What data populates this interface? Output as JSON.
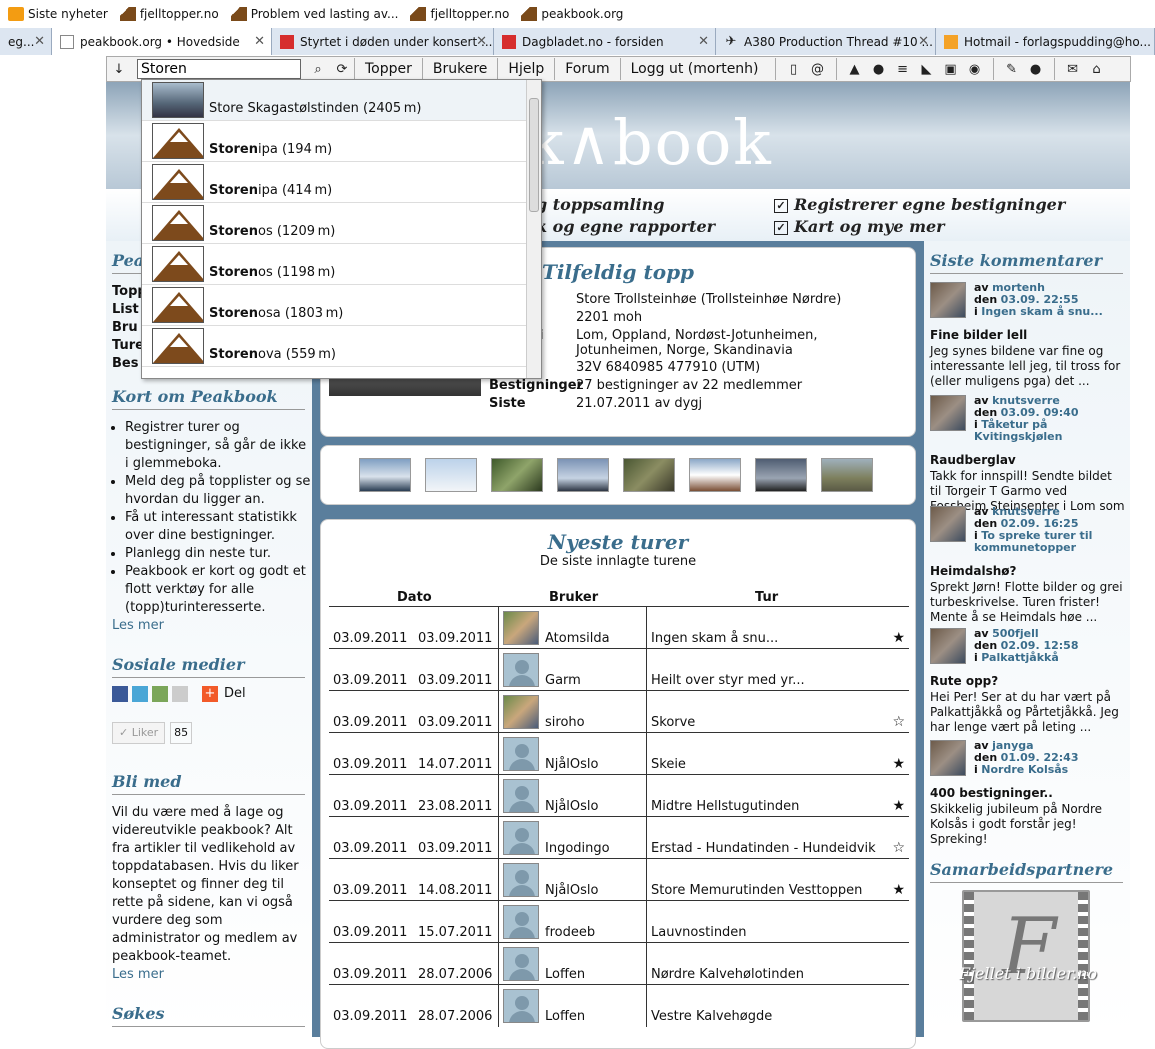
{
  "bookmarks": [
    {
      "label": "Siste nyheter",
      "icon": "rss-icon"
    },
    {
      "label": "fjelltopper.no",
      "icon": "mountain-icon"
    },
    {
      "label": "Problem ved lasting av...",
      "icon": "mountain-icon"
    },
    {
      "label": "fjelltopper.no",
      "icon": "mountain-icon"
    },
    {
      "label": "peakbook.org",
      "icon": "mountain-icon"
    }
  ],
  "tabs": [
    {
      "label": "eg..."
    },
    {
      "label": "peakbook.org • Hovedside"
    },
    {
      "label": "Styrtet i døden under konsert ..."
    },
    {
      "label": "Dagbladet.no - forsiden"
    },
    {
      "label": "A380 Production Thread #10 ..."
    },
    {
      "label": "Hotmail - forlagspudding@ho..."
    }
  ],
  "toolbar": {
    "search_value": "Storen",
    "nav": [
      "Topper",
      "Brukere",
      "Hjelp",
      "Forum",
      "Logg ut (mortenh)"
    ]
  },
  "header": {
    "logo": "k∧book"
  },
  "features": [
    "g toppsamling",
    "k og egne rapporter",
    "Registrerer egne bestigninger",
    "Kart og mye mer"
  ],
  "dropdown": [
    {
      "bold": "",
      "rest": "Store Skagastølstinden (2405 m)"
    },
    {
      "bold": "Storen",
      "rest": "ipa (194 m)"
    },
    {
      "bold": "Storen",
      "rest": "ipa (414 m)"
    },
    {
      "bold": "Storen",
      "rest": "os (1209 m)"
    },
    {
      "bold": "Storen",
      "rest": "os (1198 m)"
    },
    {
      "bold": "Storen",
      "rest": "osa (1803 m)"
    },
    {
      "bold": "Storen",
      "rest": "ova (559 m)"
    }
  ],
  "left": {
    "peak_title": "Pea",
    "peak_items": [
      "Topp",
      "List",
      "Bru",
      "Ture",
      "Bes"
    ],
    "kort_title": "Kort om Peakbook",
    "kort_items": [
      "Registrer turer og bestigninger, så går de ikke i glemmeboka.",
      "Meld deg på topplister og se hvordan du ligger an.",
      "Få ut interessant statistikk over dine bestigninger.",
      "Planlegg din neste tur.",
      "Peakbook er kort og godt et flott verktøy for alle (topp)turinteresserte."
    ],
    "les_mer": "Les mer",
    "sosiale_title": "Sosiale medier",
    "del": "Del",
    "liker": "Liker",
    "liker_count": "85",
    "bli_title": "Bli med",
    "bli_text": "Vil du være med å lage og videreutvikle peakbook? Alt fra artikler til vedlikehold av toppdatabasen. Hvis du liker konseptet og finner deg til rette på sidene, kan vi også vurdere deg som administrator og medlem av peakbook-teamet.",
    "les_mer2": "Les mer",
    "sokes_title": "Søkes"
  },
  "random": {
    "title": "Tilfeldig topp",
    "name": "Store Trollsteinhøe (Trollsteinhøe Nørdre)",
    "height": "2201 moh",
    "area_label": "i",
    "area": "Lom, Oppland, Nordøst-Jotunheimen, Jotunheimen, Norge, Skandinavia",
    "utm": "32V 6840985 477910 (UTM)",
    "best_label": "Bestigninger",
    "best": "27 bestigninger av 22 medlemmer",
    "siste_label": "Siste",
    "siste": "21.07.2011 av dygj"
  },
  "newest": {
    "title": "Nyeste turer",
    "subtitle": "De siste innlagte turene",
    "col_dato": "Dato",
    "col_bruker": "Bruker",
    "col_tur": "Tur",
    "rows": [
      {
        "d1": "03.09.2011",
        "d2": "03.09.2011",
        "user": "Atomsilda",
        "tur": "Ingen skam å snu...",
        "star": "★",
        "photo": true
      },
      {
        "d1": "03.09.2011",
        "d2": "03.09.2011",
        "user": "Garm",
        "tur": "Heilt over styr med yr...",
        "star": "",
        "photo": false
      },
      {
        "d1": "03.09.2011",
        "d2": "03.09.2011",
        "user": "siroho",
        "tur": "Skorve",
        "star": "☆",
        "photo": true
      },
      {
        "d1": "03.09.2011",
        "d2": "14.07.2011",
        "user": "NjålOslo",
        "tur": "Skeie",
        "star": "★",
        "photo": false
      },
      {
        "d1": "03.09.2011",
        "d2": "23.08.2011",
        "user": "NjålOslo",
        "tur": "Midtre Hellstugutinden",
        "star": "★",
        "photo": false
      },
      {
        "d1": "03.09.2011",
        "d2": "03.09.2011",
        "user": "Ingodingo",
        "tur": "Erstad - Hundatinden - Hundeidvik",
        "star": "☆",
        "photo": false
      },
      {
        "d1": "03.09.2011",
        "d2": "14.08.2011",
        "user": "NjålOslo",
        "tur": "Store Memurutinden Vesttoppen",
        "star": "★",
        "photo": false
      },
      {
        "d1": "03.09.2011",
        "d2": "15.07.2011",
        "user": "frodeeb",
        "tur": "Lauvnostinden",
        "star": "",
        "photo": false
      },
      {
        "d1": "03.09.2011",
        "d2": "28.07.2006",
        "user": "Loffen",
        "tur": "Nørdre Kalvehølotinden",
        "star": "",
        "photo": false
      },
      {
        "d1": "03.09.2011",
        "d2": "28.07.2006",
        "user": "Loffen",
        "tur": "Vestre Kalvehøgde",
        "star": "",
        "photo": false
      }
    ]
  },
  "right": {
    "title": "Siste kommentarer",
    "comments": [
      {
        "av": "av",
        "user": "mortenh",
        "den": "den",
        "date": "03.09. 22:55",
        "i": "i",
        "topic": "Ingen skam å snu...",
        "title": "Fine bilder lell",
        "text": "Jeg synes bildene var fine og interessante lell jeg, til tross for (eller muligens pga) det ..."
      },
      {
        "av": "av",
        "user": "knutsverre",
        "den": "den",
        "date": "03.09. 09:40",
        "i": "i",
        "topic": "Tåketur på Kvitingskjølen",
        "title": "Raudberglav",
        "text": "Takk for innspill! Sendte bildet til Torgeir T Garmo ved Fossheim Steinsenter i Lom som ..."
      },
      {
        "av": "av",
        "user": "knutsverre",
        "den": "den",
        "date": "02.09. 16:25",
        "i": "i",
        "topic": "To spreke turer til kommunetopper",
        "title": "Heimdalshø?",
        "text": "Sprekt Jørn! Flotte bilder og grei turbeskrivelse. Turen frister! Mente å se Heimdals høe ..."
      },
      {
        "av": "av",
        "user": "500fjell",
        "den": "den",
        "date": "02.09. 12:58",
        "i": "i",
        "topic": "Palkattjåkkå",
        "title": "Rute opp?",
        "text": "Hei Per! Ser at du har vært på Palkattjåkkå og Pårtetjåkkå. Jeg har lenge vært på leting ..."
      },
      {
        "av": "av",
        "user": "janyga",
        "den": "den",
        "date": "01.09. 22:43",
        "i": "i",
        "topic": "Nordre Kolsås",
        "title": "400 bestigninger..",
        "text": "Skikkelig jubileum på Nordre Kolsås i godt forstår jeg! Spreking!"
      }
    ],
    "partners_title": "Samarbeidspartnere",
    "partner": "Fjellet i bilder.no"
  }
}
